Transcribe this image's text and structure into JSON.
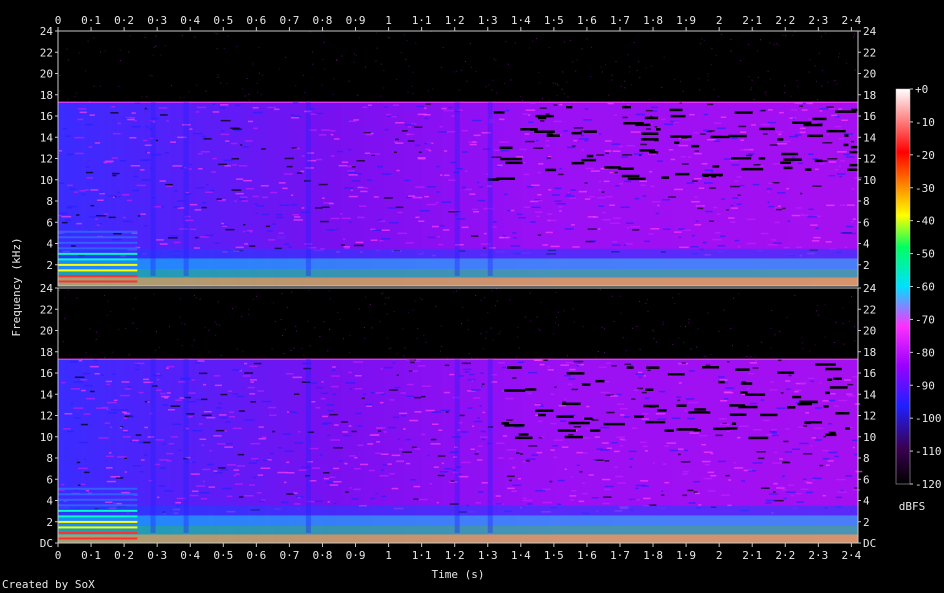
{
  "credit": "Created by SoX",
  "chart_data": {
    "type": "heatmap",
    "title": "",
    "xlabel": "Time (s)",
    "ylabel": "Frequency (kHz)",
    "colorbar_label": "dBFS",
    "x_ticks": [
      "0",
      "0·1",
      "0·2",
      "0·3",
      "0·4",
      "0·5",
      "0·6",
      "0·7",
      "0·8",
      "0·9",
      "1",
      "1·1",
      "1·2",
      "1·3",
      "1·4",
      "1·5",
      "1·6",
      "1·7",
      "1·8",
      "1·9",
      "2",
      "2·1",
      "2·2",
      "2·3",
      "2·4"
    ],
    "y_ticks_top": [
      "2",
      "4",
      "6",
      "8",
      "10",
      "12",
      "14",
      "16",
      "18",
      "20",
      "22",
      "24"
    ],
    "y_ticks_bottom": [
      "DC",
      "2",
      "4",
      "6",
      "8",
      "10",
      "12",
      "14",
      "16",
      "18",
      "20",
      "22",
      "24"
    ],
    "colorbar_ticks": [
      "+0",
      "-10",
      "-20",
      "-30",
      "-40",
      "-50",
      "-60",
      "-70",
      "-80",
      "-90",
      "-100",
      "-110",
      "-120"
    ],
    "xlim": [
      0,
      2.42
    ],
    "ylim": [
      0,
      24
    ],
    "zlim": [
      -120,
      0
    ],
    "channels": [
      {
        "name": "channel-1",
        "cutoff_khz": 17.3
      },
      {
        "name": "channel-2",
        "cutoff_khz": 17.3
      }
    ],
    "colormap": [
      "#000000",
      "#3a0050",
      "#2020ff",
      "#9a00ff",
      "#ff30ff",
      "#00ffff",
      "#00ff60",
      "#ffff00",
      "#ff8000",
      "#ff0000",
      "#ffffff"
    ]
  }
}
